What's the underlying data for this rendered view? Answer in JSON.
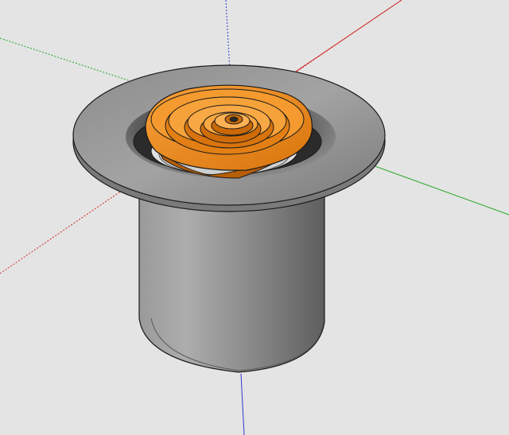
{
  "scene": {
    "background": "#e4e4e4",
    "axes": {
      "red": "#d22a2a",
      "green": "#2aa82a",
      "blue": "#2f3bd2"
    },
    "colors": {
      "metal_dark": "#3d3d3d",
      "metal_mid": "#8c8c8c",
      "metal_light": "#b6b6b6",
      "orange": "#f28a17",
      "orange_light": "#ffb347",
      "orange_dark": "#b85e07",
      "edge": "#1a1a1a"
    },
    "model": {
      "body": "cylinder-icon",
      "flange": "flange-disk-icon",
      "insert": "orange-diffuser-rings-icon"
    }
  }
}
